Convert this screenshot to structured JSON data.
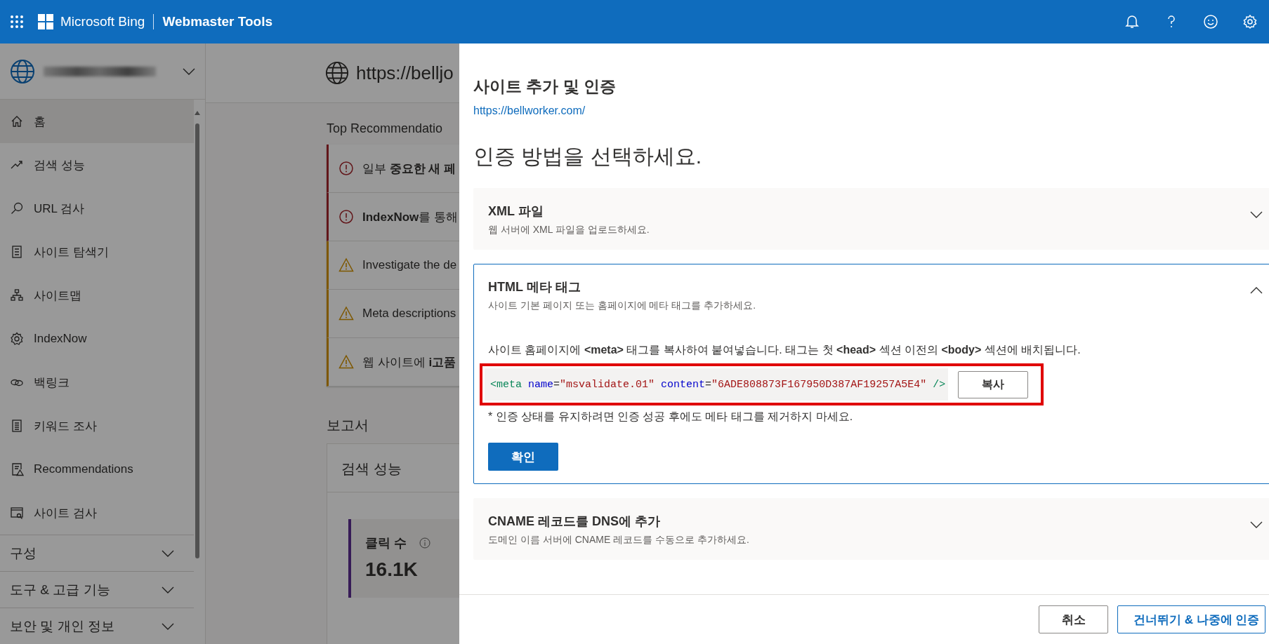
{
  "header": {
    "brand": "Microsoft Bing",
    "product": "Webmaster Tools"
  },
  "sidebar": {
    "items": [
      {
        "label": "홈",
        "selected": true
      },
      {
        "label": "검색 성능",
        "selected": false
      },
      {
        "label": "URL 검사",
        "selected": false
      },
      {
        "label": "사이트 탐색기",
        "selected": false
      },
      {
        "label": "사이트맵",
        "selected": false
      },
      {
        "label": "IndexNow",
        "selected": false
      },
      {
        "label": "백링크",
        "selected": false
      },
      {
        "label": "키워드 조사",
        "selected": false
      },
      {
        "label": "Recommendations",
        "selected": false
      },
      {
        "label": "사이트 검사",
        "selected": false
      }
    ],
    "groups": [
      {
        "label": "구성",
        "expanded": false
      },
      {
        "label": "도구 & 고급 기능",
        "expanded": false
      },
      {
        "label": "보안 및 개인 정보",
        "expanded": false
      }
    ]
  },
  "content": {
    "site_url": "https://belljo",
    "recommendations_title": "Top Recommendatio",
    "recommendations": [
      {
        "text": "일부 **중요한 새 페**",
        "kind": "error"
      },
      {
        "text": "**IndexNow**를 통해",
        "kind": "error"
      },
      {
        "text": "Investigate the de",
        "kind": "warning"
      },
      {
        "text": "Meta descriptions",
        "kind": "warning"
      },
      {
        "text": "웹 사이트에 **i고품**",
        "kind": "warning"
      }
    ],
    "reports_title": "보고서",
    "report_card": {
      "title": "검색 성능",
      "metric_label": "클릭 수",
      "metric_value": "16.1K"
    }
  },
  "panel": {
    "title": "사이트 추가 및 인증",
    "url": "https://bellworker.com/",
    "heading": "인증 방법을 선택하세요.",
    "methods": [
      {
        "title": "XML 파일",
        "description": "웹 서버에 XML 파일을 업로드하세요.",
        "expanded": false
      },
      {
        "title": "HTML 메타 태그",
        "description": "사이트 기본 페이지 또는 홈페이지에 메타 태그를 추가하세요.",
        "expanded": true,
        "instruction": "사이트 홈페이지에 **<meta>** 태그를 복사하여 붙여넣습니다. 태그는 첫 **<head>** 섹션 이전의 **<body>** 섹션에 배치됩니다.",
        "code": [
          {
            "text": "<meta",
            "kind": "tag"
          },
          {
            "text": " name",
            "kind": "attr"
          },
          {
            "text": "=",
            "kind": "punct"
          },
          {
            "text": "\"msvalidate.01\"",
            "kind": "value"
          },
          {
            "text": " content",
            "kind": "attr"
          },
          {
            "text": "=",
            "kind": "punct"
          },
          {
            "text": "\"6ADE808873F167950D387AF19257A5E4\"",
            "kind": "value"
          },
          {
            "text": " />",
            "kind": "tag"
          }
        ],
        "highlighted": true,
        "copy_button": "복사",
        "note": "* 인증 상태를 유지하려면 인증 성공 후에도 메타 태그를 제거하지 마세요.",
        "verify_button": "확인"
      },
      {
        "title": "CNAME 레코드를 DNS에 추가",
        "description": "도메인 이름 서버에 CNAME 레코드를 수동으로 추가하세요.",
        "expanded": false
      }
    ],
    "buttons": [
      {
        "label": "취소",
        "kind": "secondary"
      },
      {
        "label": "건너뛰기 & 나중에 인증",
        "kind": "outline"
      }
    ]
  }
}
